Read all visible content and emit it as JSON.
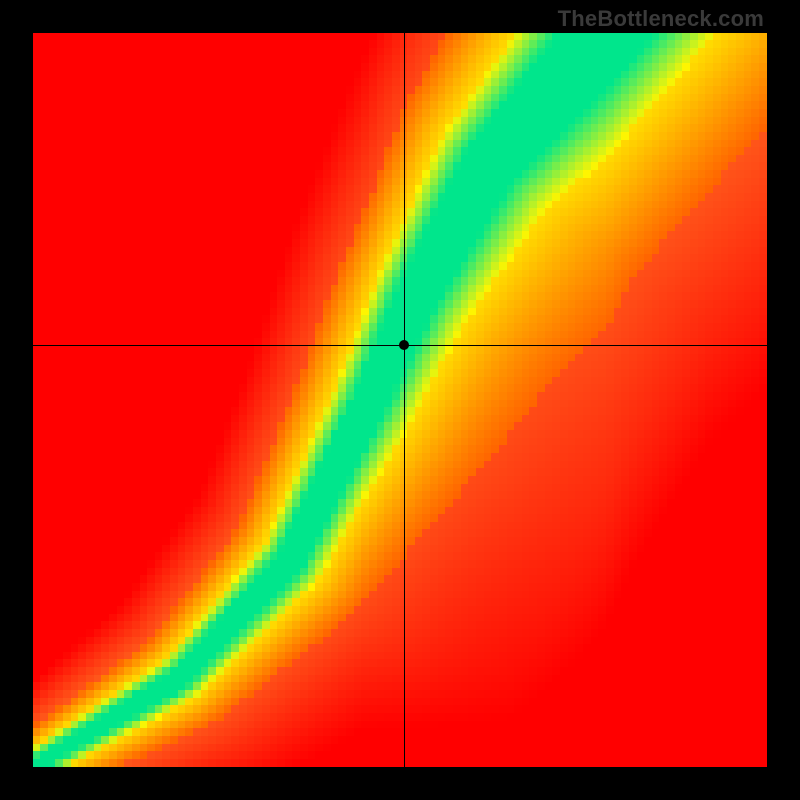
{
  "watermark": "TheBottleneck.com",
  "chart_data": {
    "type": "heatmap",
    "title": "",
    "xlabel": "",
    "ylabel": "",
    "xlim": [
      0,
      100
    ],
    "ylim": [
      0,
      100
    ],
    "grid_resolution": 96,
    "crosshair": {
      "x": 50.5,
      "y": 57.5
    },
    "marker": {
      "x": 50.5,
      "y": 57.5
    },
    "green_ridge_description": "optimal balance curve from bottom-left to top-right",
    "ridge_control_points": [
      {
        "x": 0,
        "y": 0
      },
      {
        "x": 20,
        "y": 12
      },
      {
        "x": 35,
        "y": 28
      },
      {
        "x": 45,
        "y": 48
      },
      {
        "x": 52,
        "y": 64
      },
      {
        "x": 62,
        "y": 82
      },
      {
        "x": 78,
        "y": 100
      }
    ],
    "ridge_half_width": [
      {
        "x": 0,
        "w": 1.2
      },
      {
        "x": 25,
        "w": 2.0
      },
      {
        "x": 45,
        "w": 3.0
      },
      {
        "x": 60,
        "w": 4.5
      },
      {
        "x": 78,
        "w": 6.5
      }
    ],
    "colors": {
      "low": "#ff2a3a",
      "mid": "#ffd400",
      "high": "#16exa0"
    }
  }
}
